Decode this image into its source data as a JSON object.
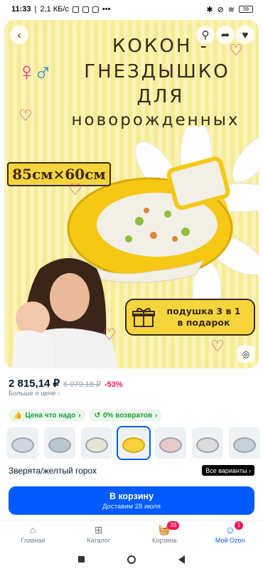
{
  "status_bar": {
    "time": "11:33",
    "network_speed": "2,1 КБ/с",
    "battery": "59",
    "more": "•••"
  },
  "hero": {
    "gender_female": "♀",
    "gender_male": "♂",
    "title_lines": [
      "КОКОН -",
      "ГНЕЗДЫШКО",
      "ДЛЯ",
      "новорожденных"
    ],
    "size": "85см×60см",
    "gift_line1": "подушка 3 в 1",
    "gift_line2": "в подарок"
  },
  "product": {
    "price": "2 815,14 ₽",
    "old_price": "6 079,18 ₽",
    "discount": "-53%",
    "more_price": "Больше о цене ›"
  },
  "chips": [
    {
      "label": "Цена что надо",
      "icon": "thumb-up-icon"
    },
    {
      "label": "0% возвратов",
      "icon": "return-icon"
    }
  ],
  "variant": {
    "label": "Зверята/желтый горох",
    "all_variants": "Все варианты ›"
  },
  "cart": {
    "title": "В корзину",
    "subtitle": "Доставим 28 июля"
  },
  "nav": {
    "home": "Главная",
    "catalog": "Каталог",
    "cart": "Корзина",
    "cart_badge": "33",
    "profile": "Мой Ozon",
    "profile_badge": "1"
  },
  "colors": {
    "accent": "#005bff",
    "discount": "#f91155",
    "chip_green": "#10a133"
  }
}
